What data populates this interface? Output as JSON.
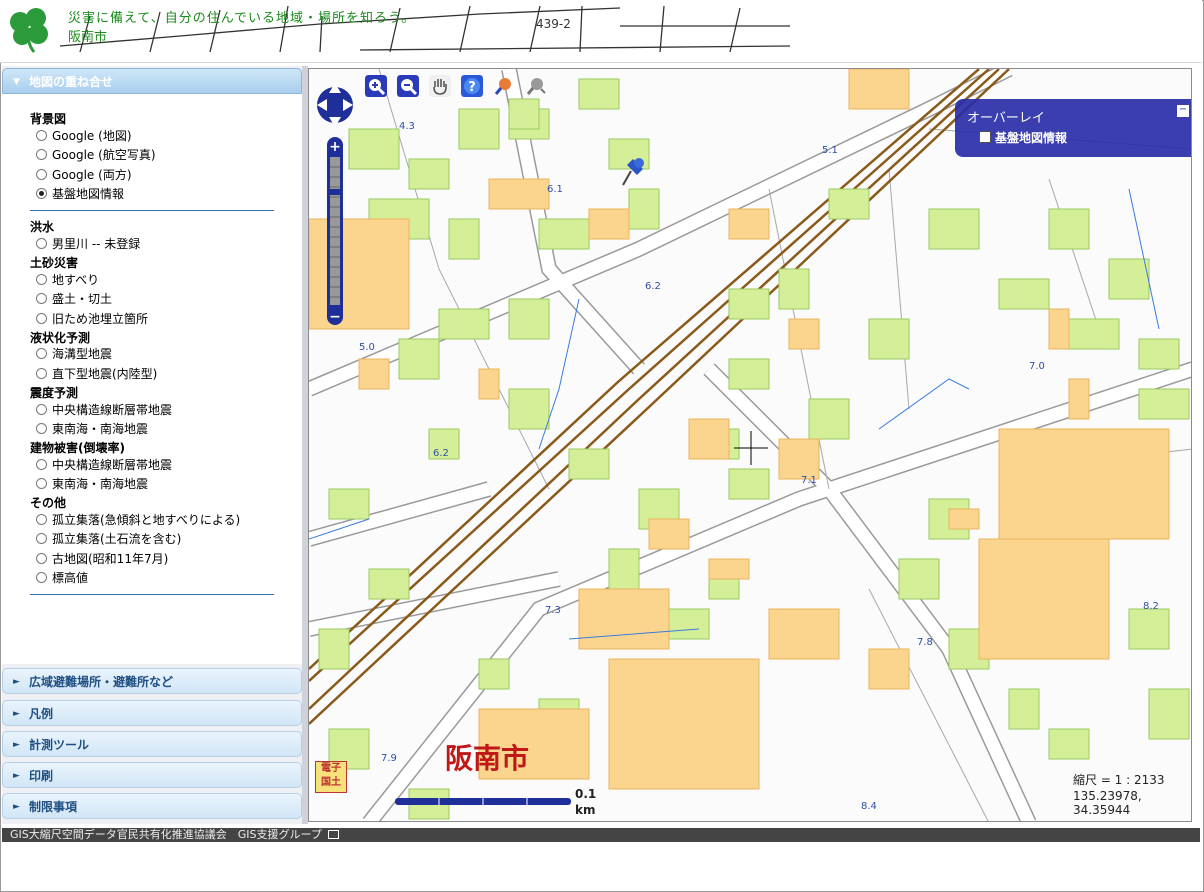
{
  "header": {
    "tagline": "災害に備えて、自分の住んでいる地域・場所を知ろう。",
    "city_link": "阪南市"
  },
  "sidebar": {
    "layers_header": "地図の重ね合せ",
    "groups": {
      "background": {
        "label": "背景図",
        "options": [
          "Google (地図)",
          "Google (航空写真)",
          "Google (両方)",
          "基盤地図情報"
        ],
        "selected": "基盤地図情報"
      },
      "flood": {
        "label": "洪水",
        "options": [
          "男里川 -- 未登録"
        ]
      },
      "landslide": {
        "label": "土砂災害",
        "options": [
          "地すべり",
          "盛土・切土",
          "旧ため池埋立箇所"
        ]
      },
      "liquefaction": {
        "label": "液状化予測",
        "options": [
          "海溝型地震",
          "直下型地震(内陸型)"
        ]
      },
      "seismic": {
        "label": "震度予測",
        "options": [
          "中央構造線断層帯地震",
          "東南海・南海地震"
        ]
      },
      "building": {
        "label": "建物被害(倒壊率)",
        "options": [
          "中央構造線断層帯地震",
          "東南海・南海地震"
        ]
      },
      "other": {
        "label": "その他",
        "options": [
          "孤立集落(急傾斜と地すべりによる)",
          "孤立集落(土石流を含む)",
          "古地図(昭和11年7月)",
          "標高値"
        ]
      }
    },
    "collapsed_sections": [
      "広域避難場所・避難所など",
      "凡例",
      "計測ツール",
      "印刷",
      "制限事項"
    ]
  },
  "map": {
    "overlay": {
      "title": "オーバーレイ",
      "item": "基盤地図情報",
      "checked": false
    },
    "scale_text": "縮尺 = 1 : 2133",
    "coordinates": "135.23978, 34.35944",
    "city_label": "阪南市",
    "scalebar": {
      "value": "0.1",
      "unit": "km"
    },
    "gsi_logo": [
      "電子",
      "国土"
    ],
    "elevation_labels": [
      "4.3",
      "6.1",
      "5.1",
      "6.2",
      "5.0",
      "7.0",
      "6.2",
      "7.1",
      "7.3",
      "7.8",
      "8.2",
      "7.9",
      "8.4"
    ],
    "tools": [
      "zoom-in-icon",
      "zoom-out-icon",
      "hand-pan-icon",
      "help-icon",
      "search-pin-icon",
      "measure-icon"
    ]
  },
  "footer": {
    "text": "GIS大縮尺空間データ官民共有化推進協議会　GIS支援グループ"
  },
  "colors": {
    "building_fill": "#d4ef98",
    "large_building_fill": "#fbd58e",
    "railway": "#8a5a1a",
    "overlay_panel": "#2a2ea8",
    "accent_green": "#1a8a1a",
    "city_label": "#c01818"
  }
}
